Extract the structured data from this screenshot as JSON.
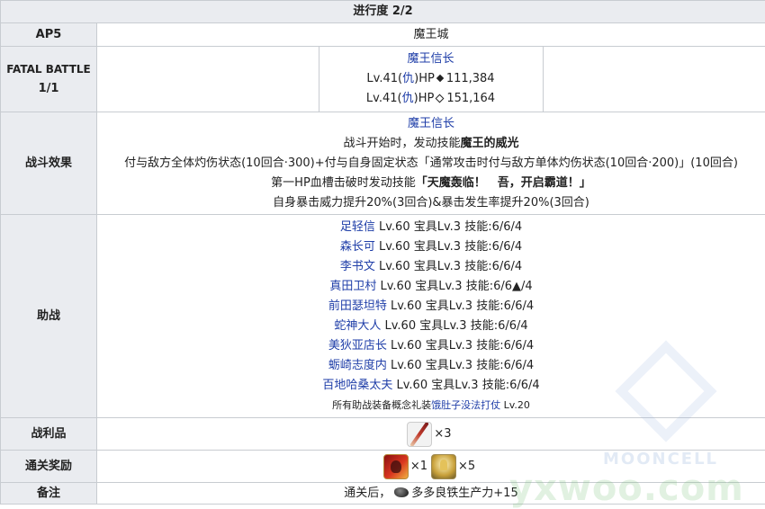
{
  "progress": "进行度 2/2",
  "ap": {
    "label": "AP5",
    "location": "魔王城"
  },
  "fatal_battle": {
    "label_line1": "FATAL BATTLE",
    "label_line2": "1/1",
    "enemy_name": "魔王信长",
    "enemy_line1": {
      "lv": "Lv.41(",
      "cls": "仇",
      "hp": ")HP",
      "val": "111,384"
    },
    "enemy_line2": {
      "lv": "Lv.41(",
      "cls": "仇",
      "hp": ")HP",
      "val": "151,164"
    }
  },
  "effects": {
    "label": "战斗效果",
    "name": "魔王信长",
    "line1a": "战斗开始时，发动技能",
    "line1b": "魔王的威光",
    "line2": "付与敌方全体灼伤状态(10回合·300)+付与自身固定状态「通常攻击时付与敌方单体灼伤状态(10回合·200)」(10回合)",
    "line3a": "第一HP血槽击破时发动技能",
    "line3b": "「天魔轰临！　吾，开启霸道！」",
    "line4": "自身暴击威力提升20%(3回合)&暴击发生率提升20%(3回合)"
  },
  "support": {
    "label": "助战",
    "rows": [
      {
        "name": "足轻信",
        "stats": " Lv.60 宝具Lv.3 技能:6/6/4"
      },
      {
        "name": "森长可",
        "stats": " Lv.60 宝具Lv.3 技能:6/6/4"
      },
      {
        "name": "李书文",
        "stats": " Lv.60 宝具Lv.3 技能:6/6/4"
      },
      {
        "name": "真田卫村",
        "stats": " Lv.60 宝具Lv.3 技能:6/6▲/4"
      },
      {
        "name": "前田瑟坦特",
        "stats": " Lv.60 宝具Lv.3 技能:6/6/4"
      },
      {
        "name": "蛇神大人",
        "stats": " Lv.60 宝具Lv.3 技能:6/6/4"
      },
      {
        "name": "美狄亚店长",
        "stats": " Lv.60 宝具Lv.3 技能:6/6/4"
      },
      {
        "name": "蛎崎志度内",
        "stats": " Lv.60 宝具Lv.3 技能:6/6/4"
      },
      {
        "name": "百地哈桑太夫",
        "stats": " Lv.60 宝具Lv.3 技能:6/6/4"
      }
    ],
    "ce_prefix": "所有助战装备概念礼装",
    "ce_name": "饿肚子没法打仗",
    "ce_lv": " Lv.20"
  },
  "drops": {
    "label": "战利品",
    "count": "×3"
  },
  "rewards": {
    "label": "通关奖励",
    "count1": "×1",
    "count2": "×5"
  },
  "notes": {
    "label": "备注",
    "text_a": "通关后，",
    "text_b": "多多良铁生产力+15"
  },
  "watermark": {
    "brand": "yxwoo.com",
    "brand2": "MOONCELL"
  },
  "colors": {
    "link": "#1f3ea8",
    "header_bg": "#eaecf0",
    "border": "#c8ccd1"
  }
}
